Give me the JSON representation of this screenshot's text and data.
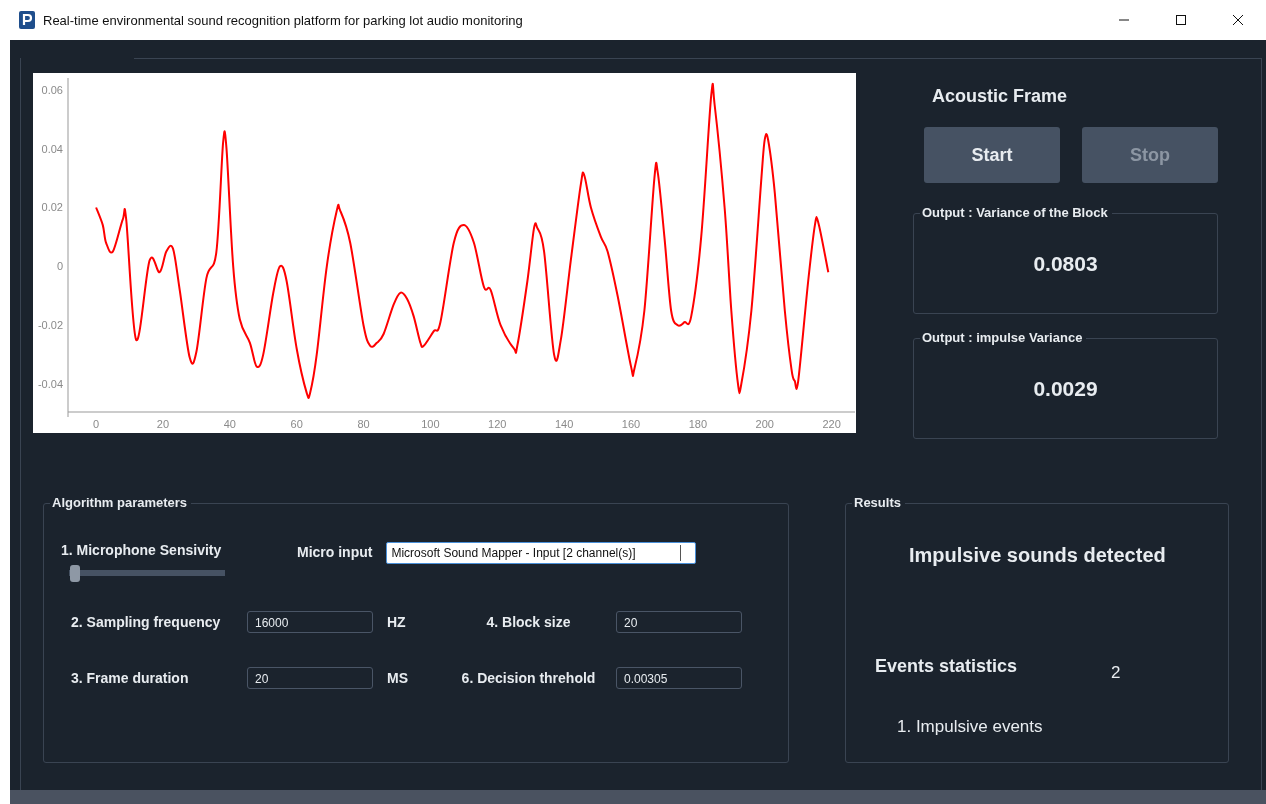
{
  "window": {
    "title": "Real-time environmental sound recognition platform for parking lot audio monitoring"
  },
  "chart": {
    "chart_data": {
      "type": "line",
      "xlim": [
        -8.4,
        227
      ],
      "ylim": [
        -0.0495,
        0.064
      ],
      "xticks": [
        0,
        20,
        40,
        60,
        80,
        100,
        120,
        140,
        160,
        180,
        200,
        220
      ],
      "yticks": [
        -0.04,
        -0.02,
        0,
        0.02,
        0.04,
        0.06
      ],
      "x": [
        0,
        2,
        3,
        5,
        8,
        9,
        12,
        16,
        19,
        21,
        23,
        25,
        28,
        30,
        33,
        36,
        38,
        39,
        41,
        43,
        46,
        48,
        50,
        53,
        55,
        57,
        60,
        63,
        64,
        66,
        69,
        72,
        73,
        76,
        80,
        82,
        84,
        86,
        89,
        91,
        93,
        95,
        97,
        98,
        101,
        103,
        107,
        110,
        113,
        116,
        118,
        121,
        125,
        126,
        129,
        131,
        132,
        134,
        137,
        139,
        142,
        145,
        146,
        148,
        151,
        153,
        156,
        160,
        161,
        164,
        167,
        168,
        170,
        172,
        174,
        176,
        178,
        181,
        184,
        185,
        188,
        190,
        192,
        193,
        196,
        199,
        200,
        201,
        203,
        206,
        208,
        209,
        210,
        213,
        215,
        216,
        219
      ],
      "series": [
        {
          "color": "#ff0000",
          "values": [
            0.02,
            0.014,
            0.008,
            0.005,
            0.016,
            0.016,
            -0.025,
            0.002,
            -0.002,
            0.005,
            0.006,
            -0.008,
            -0.031,
            -0.029,
            -0.004,
            0.005,
            0.042,
            0.04,
            0.0,
            -0.018,
            -0.026,
            -0.034,
            -0.03,
            -0.009,
            0.0,
            -0.005,
            -0.028,
            -0.043,
            -0.043,
            -0.03,
            0.0,
            0.019,
            0.019,
            0.008,
            -0.02,
            -0.027,
            -0.026,
            -0.023,
            -0.013,
            -0.009,
            -0.011,
            -0.017,
            -0.026,
            -0.027,
            -0.022,
            -0.019,
            0.008,
            0.014,
            0.008,
            -0.007,
            -0.008,
            -0.02,
            -0.028,
            -0.027,
            -0.005,
            0.013,
            0.013,
            0.005,
            -0.03,
            -0.025,
            0.002,
            0.028,
            0.031,
            0.02,
            0.01,
            0.005,
            -0.01,
            -0.034,
            -0.035,
            -0.015,
            0.03,
            0.032,
            0.01,
            -0.015,
            -0.02,
            -0.019,
            -0.017,
            0.01,
            0.058,
            0.055,
            0.02,
            -0.015,
            -0.04,
            -0.04,
            -0.015,
            0.03,
            0.043,
            0.043,
            0.025,
            -0.015,
            -0.035,
            -0.039,
            -0.039,
            -0.005,
            0.014,
            0.015,
            -0.002
          ]
        }
      ]
    }
  },
  "acoustic_frame": {
    "title": "Acoustic Frame",
    "buttons": [
      {
        "label": "Start",
        "disabled": false
      },
      {
        "label": "Stop",
        "disabled": true
      }
    ],
    "outputs": [
      {
        "legend": "Output : Variance of the Block",
        "value": "0.0803"
      },
      {
        "legend": "Output : impulse Variance",
        "value": "0.0029"
      }
    ]
  },
  "algorithm_parameters": {
    "legend": "Algorithm parameters",
    "sensitivity": {
      "label": "1. Microphone Sensivity",
      "level": 0
    },
    "micro_input": {
      "label": "Micro input",
      "value": "Microsoft Sound Mapper - Input [2 channel(s)]"
    },
    "fields": [
      {
        "label": "2. Sampling frequency",
        "value": "16000",
        "unit": "HZ"
      },
      {
        "label": "4. Block size",
        "value": "20"
      },
      {
        "label": "3. Frame duration",
        "value": "20",
        "unit": "MS"
      },
      {
        "label": "6. Decision threhold",
        "value": "0.00305"
      }
    ]
  },
  "results": {
    "legend": "Results",
    "status": "Impulsive sounds detected",
    "stats_title": "Events statistics",
    "stats_count": "2",
    "stats_item": "1. Impulsive events"
  }
}
